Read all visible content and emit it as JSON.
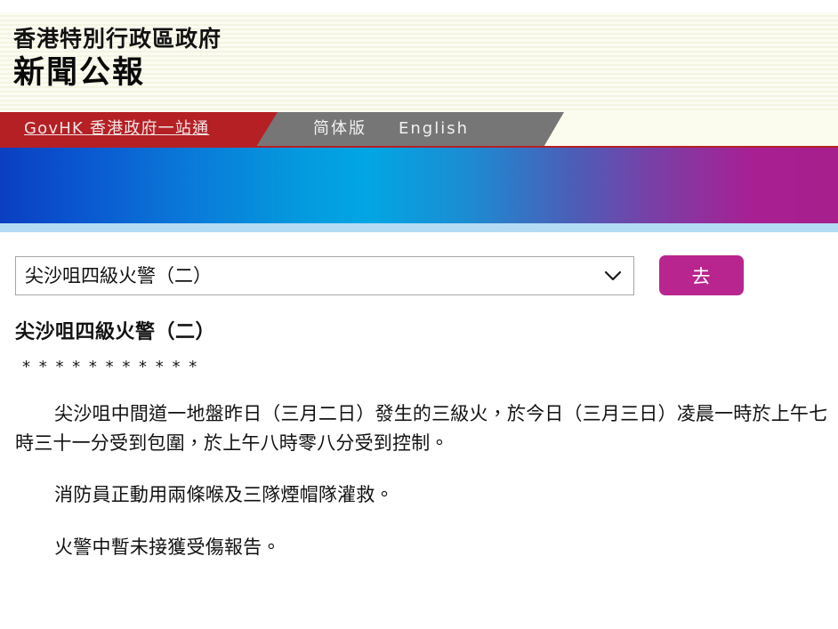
{
  "header": {
    "gov_name": "香港特別行政區政府",
    "press_name": "新聞公報"
  },
  "nav": {
    "govhk_label": "GovHK 香港政府一站通",
    "links": [
      {
        "label": "简体版"
      },
      {
        "label": "English"
      }
    ]
  },
  "selector": {
    "selected_option": "尖沙咀四級火警（二）",
    "options": [
      "尖沙咀四級火警（二）"
    ],
    "go_label": "去",
    "chevron_icon": "chevron-down-icon"
  },
  "article": {
    "title": "尖沙咀四級火警（二）",
    "stars": "* * * * * * * * * * *",
    "paragraphs": [
      "尖沙咀中間道一地盤昨日（三月二日）發生的三級火，於今日（三月三日）凌晨一時於上午七時三十一分受到包圍，於上午八時零八分受到控制。",
      "消防員正動用兩條喉及三隊煙帽隊灌救。",
      "火警中暫未接獲受傷報告。"
    ]
  },
  "colors": {
    "header_cream": "#fbfbee",
    "nav_red": "#b52025",
    "nav_gray": "#767676",
    "banner_start": "#0a3fc0",
    "banner_mid": "#02a6e3",
    "banner_end": "#a61f8c",
    "banner_underline": "#b3dcf4",
    "go_button": "#b8258f"
  }
}
